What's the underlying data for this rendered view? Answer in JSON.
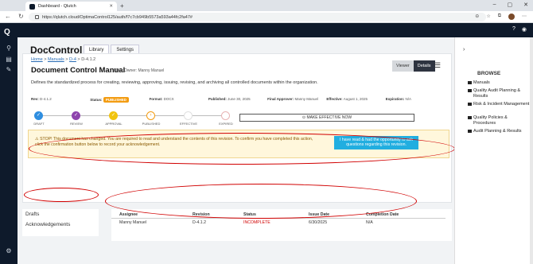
{
  "browser": {
    "tab_title": "Dashboard - Qlutch",
    "url": "https://qlutch.cloud/OptimaControl125/auth/f7c7cb949b5573a593a44fc2fa47#"
  },
  "app": {
    "name": "DocControl",
    "tabs": [
      "Library",
      "Settings"
    ],
    "active_tab": "Library"
  },
  "breadcrumb": [
    "Home",
    "Manuals",
    "D-4",
    "D-4.1.2"
  ],
  "doc": {
    "title": "Document Control Manual",
    "owner": "| Doc Owner: Manny Manuel",
    "description": "Defines the standardized process for creating, reviewing, approving, issuing, revising, and archiving all controlled documents within the organization."
  },
  "view_toggle": {
    "viewer": "Viewer",
    "details": "Details"
  },
  "meta": {
    "rev_label": "Rev:",
    "rev": "D-4.1.2",
    "status_label": "Status:",
    "status": "PUBLISHED",
    "format_label": "Format:",
    "format": "DOCX",
    "published_label": "Published:",
    "published": "June 30, 2025",
    "approver_label": "Final Approver:",
    "approver": "Manny Manuel",
    "effective_label": "Effective:",
    "effective": "August 1, 2025",
    "expiration_label": "Expiration:",
    "expiration": "N/A"
  },
  "steps": [
    {
      "label": "DRAFT",
      "state": "done",
      "color": "#2f8ee0"
    },
    {
      "label": "REVIEW",
      "state": "done",
      "color": "#8e44ad"
    },
    {
      "label": "APPROVAL",
      "state": "done",
      "color": "#f1c40f"
    },
    {
      "label": "PUBLISHED",
      "state": "current",
      "color": "#f39c12"
    },
    {
      "label": "EFFECTIVE",
      "state": "todo",
      "color": "#e0e0e0"
    },
    {
      "label": "EXPIRED",
      "state": "todo",
      "color": "#e8b4b4"
    }
  ],
  "make_effective": "MAKE EFFECTIVE NOW",
  "warning": {
    "text": "⚠ STOP! This document has changed. You are required to read and understand the contents of this revision. To confirm you have completed this action, click the confirmation button below to record your acknowledgement.",
    "button": "I have read & had the opportunity to ask questions regarding this revision."
  },
  "left_list": [
    "Drafts",
    "Acknowledgements"
  ],
  "table": {
    "headers": [
      "Assignee",
      "Revision",
      "Status",
      "Issue Date",
      "Completion Date"
    ],
    "row": [
      "Manny Manuel",
      "D-4.1.2",
      "INCOMPLETE",
      "6/30/2025",
      "N/A"
    ],
    "status_color": "#d10000"
  },
  "browse": {
    "title": "BROWSE",
    "items": [
      "Manuals",
      "Quality Audit Planning & Results",
      "Risk & Incident Management",
      "Quality Policies & Procedures",
      "Audit Planning & Results"
    ]
  }
}
